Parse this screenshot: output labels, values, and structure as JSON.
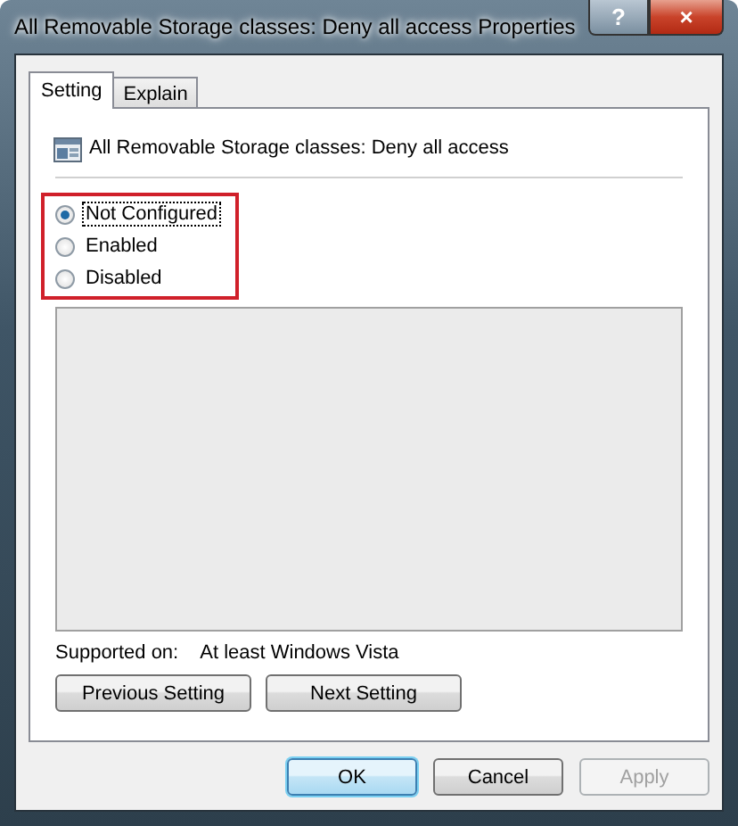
{
  "window": {
    "title": "All Removable Storage classes: Deny all access Properties",
    "title_buttons": [
      {
        "kind": "help",
        "label": "?"
      },
      {
        "kind": "close",
        "label": "×"
      }
    ]
  },
  "tabs": [
    {
      "label": "Setting",
      "selected": true
    },
    {
      "label": "Explain",
      "selected": false
    }
  ],
  "policy": {
    "name": "All Removable Storage classes: Deny all access"
  },
  "radio_group": {
    "highlighted": true,
    "options": [
      {
        "label": "Not Configured",
        "selected": true,
        "focused": true
      },
      {
        "label": "Enabled",
        "selected": false,
        "focused": false
      },
      {
        "label": "Disabled",
        "selected": false,
        "focused": false
      }
    ]
  },
  "supported_on": {
    "label": "Supported on:",
    "value": "At least Windows Vista"
  },
  "nav_buttons": [
    "Previous Setting",
    "Next Setting"
  ],
  "buttons": [
    {
      "label": "OK",
      "default": true,
      "disabled": false
    },
    {
      "label": "Cancel",
      "default": false,
      "disabled": false
    },
    {
      "label": "Apply",
      "default": false,
      "disabled": true
    }
  ]
}
